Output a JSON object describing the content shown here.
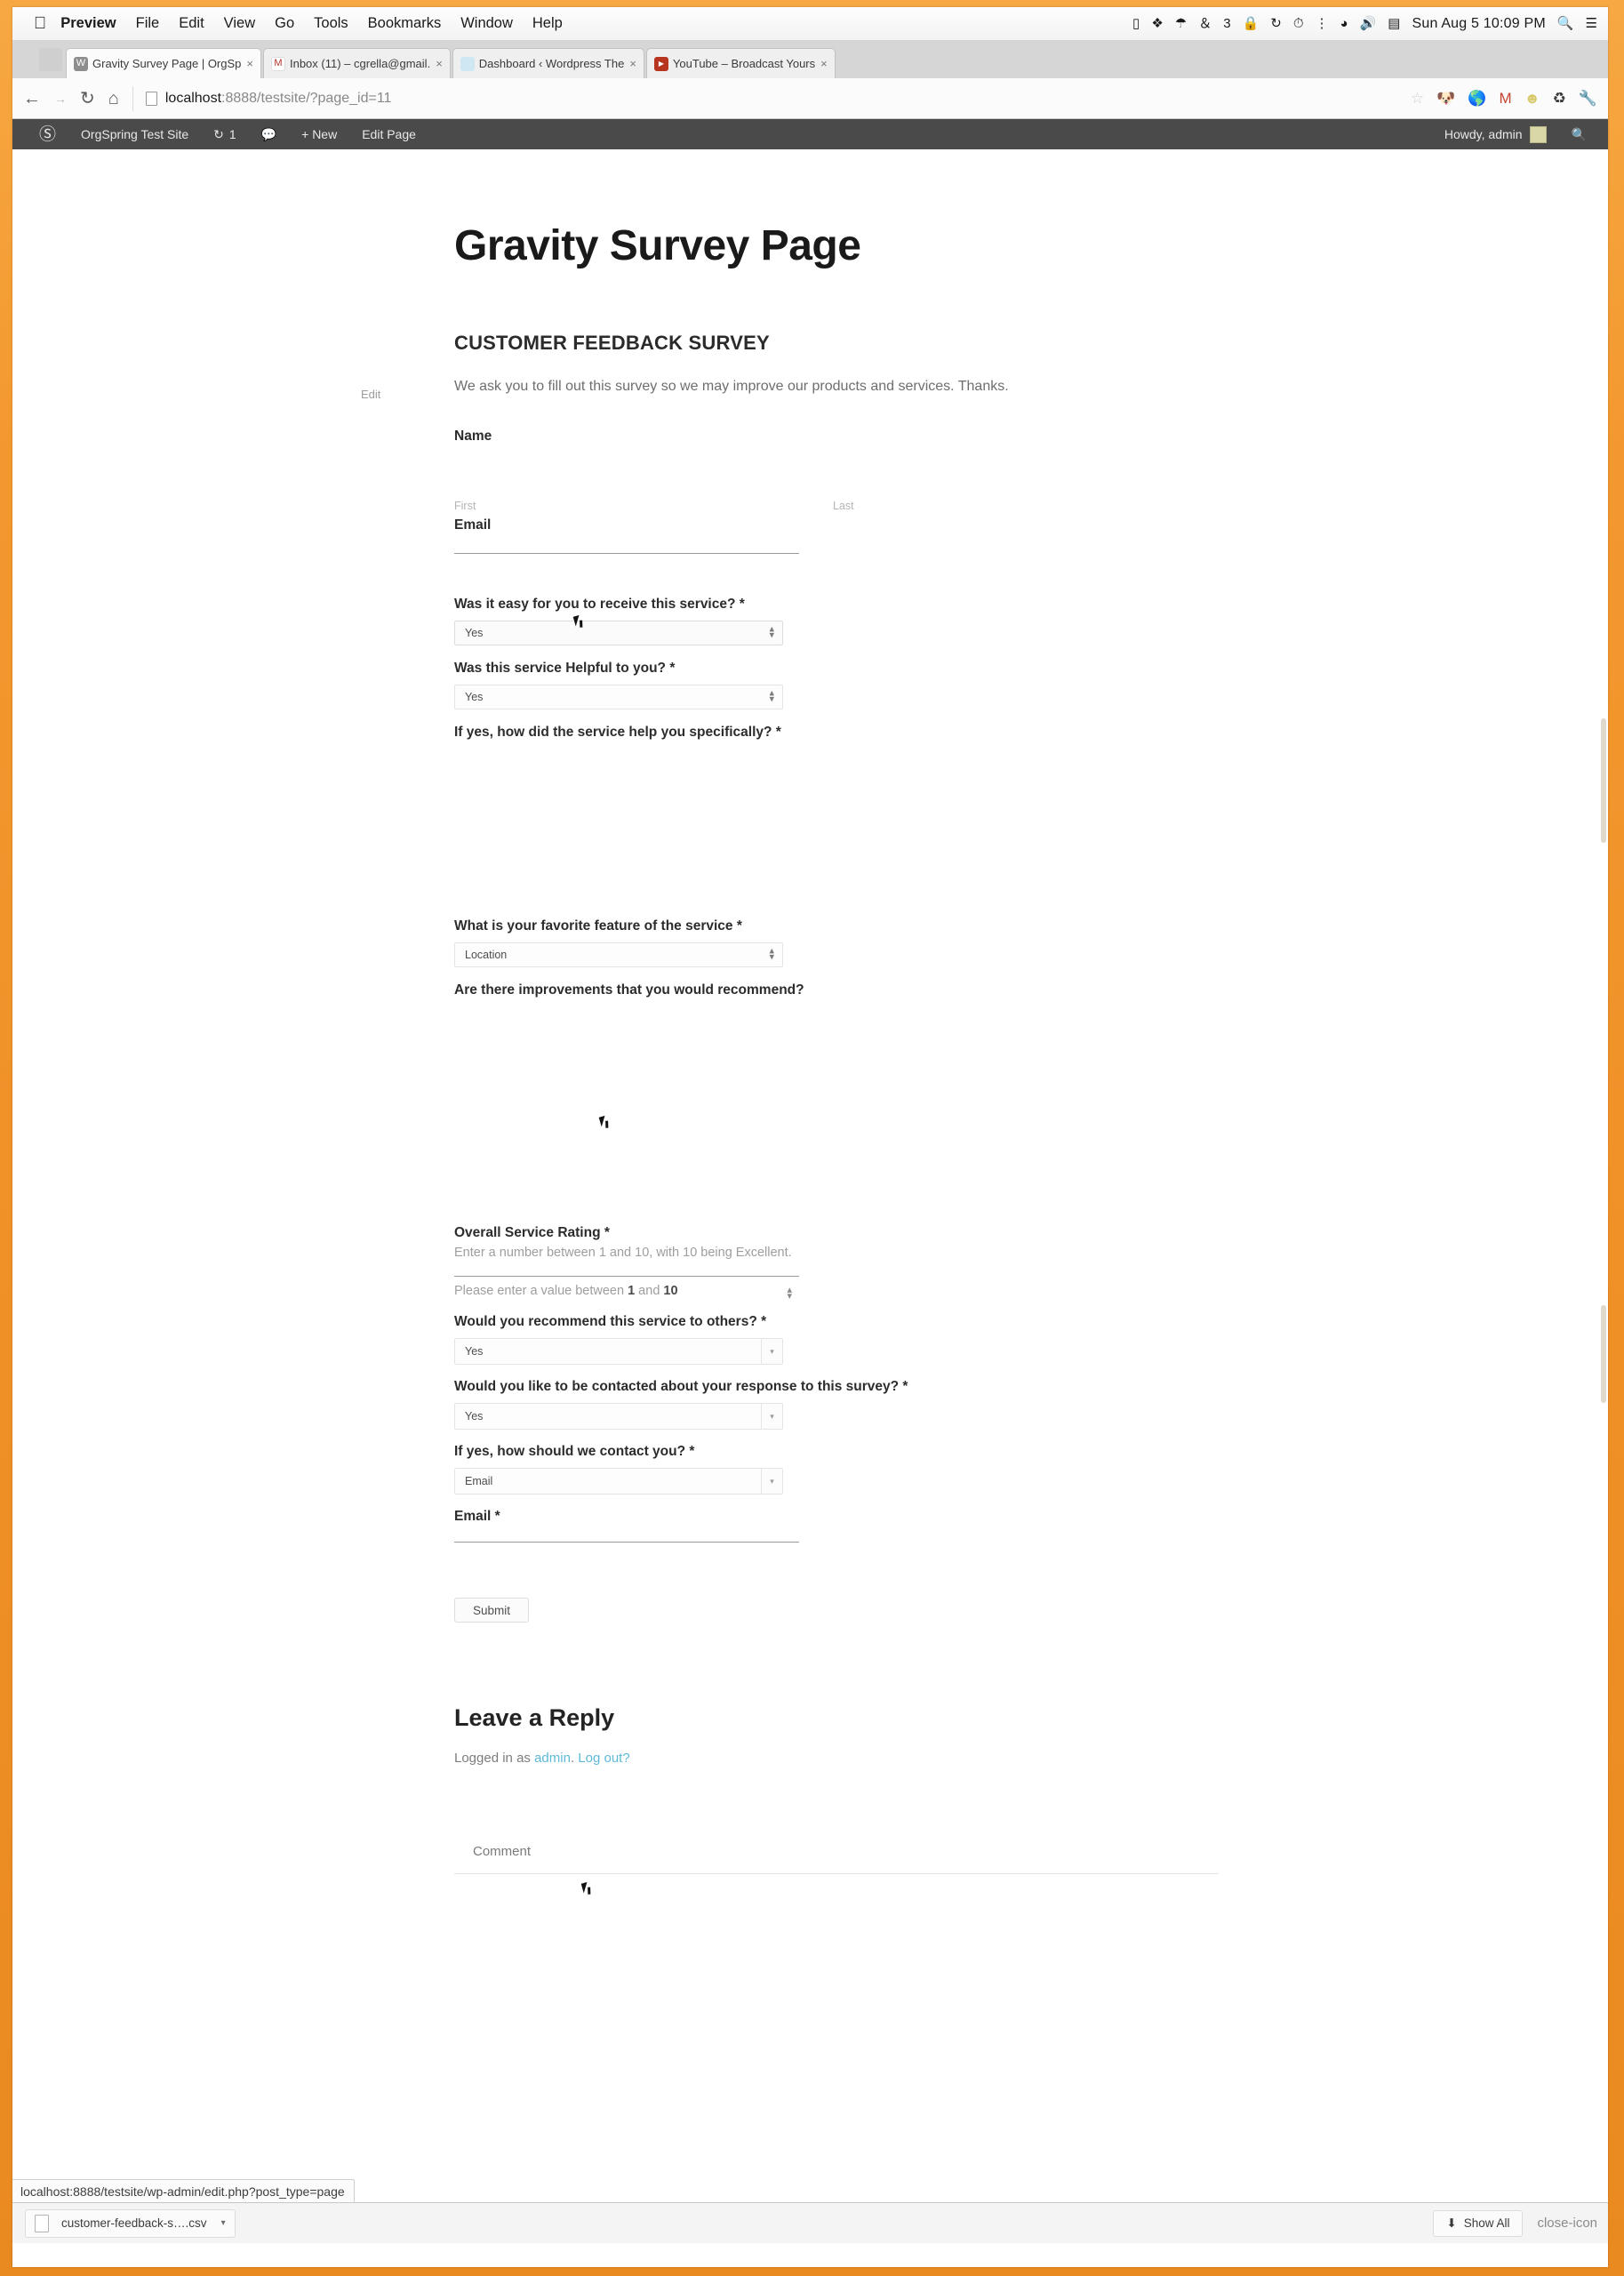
{
  "macos_menubar": {
    "apple_icon": "apple-logo-icon",
    "app_name": "Preview",
    "menus": [
      "File",
      "Edit",
      "View",
      "Go",
      "Tools",
      "Bookmarks",
      "Window",
      "Help"
    ],
    "status_icons": [
      "screen-recording-icon",
      "dropbox-icon",
      "cloud-icon",
      "fontagent-icon",
      "lock-icon",
      "sync-icon",
      "timemachine-icon",
      "bluetooth-icon",
      "wifi-icon",
      "volume-icon",
      "battery-icon"
    ],
    "font_badge": "3",
    "clock": "Sun Aug 5  10:09 PM",
    "search_icon": "spotlight-search-icon",
    "list_icon": "notification-center-icon"
  },
  "browser": {
    "tabs": [
      {
        "title": "Gravity Survey Page | OrgSp",
        "favicon": "wordpress-favicon",
        "favicon_color": "#8d8d8d",
        "favicon_glyph": "W",
        "active": true,
        "close_label": "×"
      },
      {
        "title": "Inbox (11) – cgrella@gmail.",
        "favicon": "gmail-favicon",
        "favicon_color": "#ffffff",
        "favicon_glyph": "M",
        "active": false,
        "close_label": "×"
      },
      {
        "title": "Dashboard ‹ Wordpress The",
        "favicon": "wordpress-dash-favicon",
        "favicon_color": "#cfe7f2",
        "favicon_glyph": "",
        "active": false,
        "close_label": "×"
      },
      {
        "title": "YouTube – Broadcast Yours",
        "favicon": "youtube-favicon",
        "favicon_color": "#b7341f",
        "favicon_glyph": "▶",
        "active": false,
        "close_label": "×"
      }
    ],
    "nav": {
      "back_icon": "back-arrow-icon",
      "forward_icon": "forward-arrow-icon",
      "reload_icon": "reload-icon",
      "home_icon": "home-icon"
    },
    "url": {
      "host": "localhost",
      "path": ":8888/testsite/?page_id=11",
      "page_icon": "page-document-icon"
    },
    "toolbar_icons": [
      "bookmark-star-icon",
      "extension-dog-icon",
      "extension-globe-icon",
      "gmail-checker-icon",
      "extension-smiley-icon",
      "recycle-icon",
      "wrench-menu-icon"
    ],
    "status_bubble": "localhost:8888/testsite/wp-admin/edit.php?post_type=page"
  },
  "wp_adminbar": {
    "logo_icon": "wordpress-logo-icon",
    "site_name": "OrgSpring Test Site",
    "updates_icon": "updates-icon",
    "updates_count": "1",
    "comments_icon": "comments-bubble-icon",
    "new_label": "+ New",
    "edit_page_label": "Edit Page",
    "howdy": "Howdy, admin",
    "avatar": "admin-avatar",
    "search_icon": "wp-search-icon"
  },
  "page": {
    "edit_link": "Edit",
    "title": "Gravity Survey Page"
  },
  "form": {
    "heading": "CUSTOMER FEEDBACK SURVEY",
    "description": "We ask you to fill out this survey so we may improve our products and services. Thanks.",
    "required_mark": "*",
    "fields": {
      "name": {
        "label": "Name",
        "first_sublabel": "First",
        "last_sublabel": "Last",
        "first_value": "",
        "last_value": ""
      },
      "email_top": {
        "label": "Email",
        "value": ""
      },
      "easy_service": {
        "label": "Was it easy for you to receive this service?",
        "required": "*",
        "value": "Yes"
      },
      "helpful_service": {
        "label": "Was this service Helpful to you?",
        "required": "*",
        "value": "Yes"
      },
      "help_specifically": {
        "label": "If yes, how did the service help you specifically?",
        "required": "*",
        "value": ""
      },
      "favorite_feature": {
        "label": "What is your favorite feature of the service",
        "required": "*",
        "value": "Location"
      },
      "improvements": {
        "label": "Are there improvements that you would recommend?",
        "required": "",
        "value": ""
      },
      "overall_rating": {
        "label": "Overall Service Rating",
        "required": "*",
        "description": "Enter a number between 1 and 10, with 10 being Excellent.",
        "value": "",
        "validation_prefix": "Please enter a value between ",
        "validation_min": "1",
        "validation_middle": " and ",
        "validation_max": "10"
      },
      "recommend_others": {
        "label": "Would you recommend this service to others?",
        "required": "*",
        "value": "Yes"
      },
      "be_contacted": {
        "label": "Would you like to be contacted about your response to this survey?",
        "required": "*",
        "value": "Yes"
      },
      "contact_method": {
        "label": "If yes, how should we contact you?",
        "required": "*",
        "value": "Email"
      },
      "email_bottom": {
        "label": "Email",
        "required": "*",
        "value": ""
      }
    },
    "submit_label": "Submit"
  },
  "comments": {
    "reply_title": "Leave a Reply",
    "logged_in_prefix": "Logged in as ",
    "logged_in_user": "admin",
    "logged_in_sep": ". ",
    "logout_label": "Log out?",
    "comment_label": "Comment"
  },
  "downloads": {
    "file_name": "customer-feedback-s….csv",
    "file_icon": "csv-file-icon",
    "caret_icon": "chevron-down-icon",
    "show_all_label": "Show All",
    "show_all_icon": "download-arrow-icon",
    "close_icon": "close-icon"
  },
  "colors": {
    "frame_orange": "#ef9026",
    "wp_adminbar": "#4a4a4a",
    "link_blue": "#5fb8d8",
    "text_dark": "#2c2c2c",
    "text_muted": "#9e9e9e"
  }
}
